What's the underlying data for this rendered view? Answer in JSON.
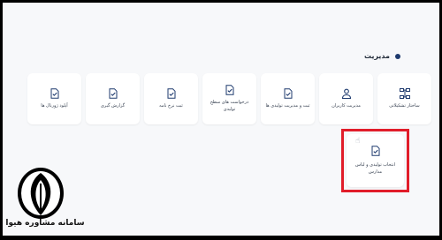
{
  "section": {
    "title": "مدیریت"
  },
  "cards": [
    {
      "label": "ساختار تشکیلاتی",
      "icon": "org-chart-icon"
    },
    {
      "label": "مدیریت کاربران",
      "icon": "user-icon"
    },
    {
      "label": "ثبت و مدیریت تولیدی ها",
      "icon": "doc-check-icon"
    },
    {
      "label": "درخواست های سطح تولیدی",
      "icon": "doc-check-icon"
    },
    {
      "label": "ثبت نرخ نامه",
      "icon": "doc-check-icon"
    },
    {
      "label": "گزارش گیری",
      "icon": "doc-check-icon"
    },
    {
      "label": "آپلود ژورنال ها",
      "icon": "doc-check-icon"
    }
  ],
  "highlighted_card": {
    "label": "انتخاب تولیدی و لباس مدارس",
    "icon": "doc-check-icon"
  },
  "watermark": {
    "text": "سامانه مشاوره هیوا"
  },
  "colors": {
    "accent": "#1e3a6e",
    "highlight": "#e11d2a",
    "background": "#f7f8fa"
  }
}
